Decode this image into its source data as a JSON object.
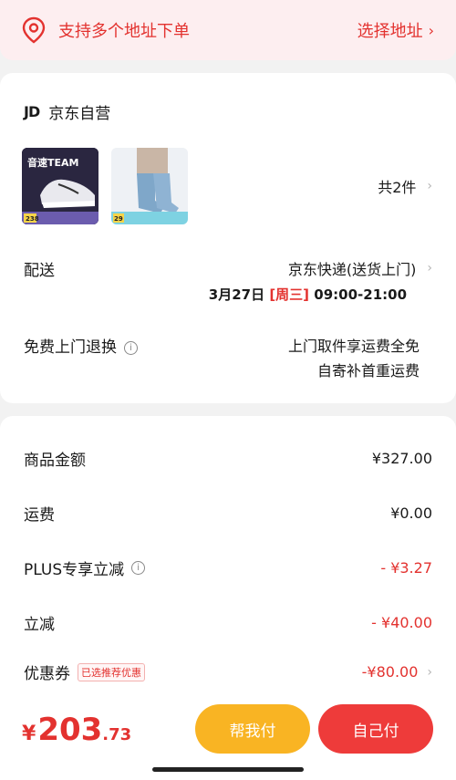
{
  "address_bar": {
    "text": "支持多个地址下单",
    "action": "选择地址"
  },
  "shop": {
    "logo": "JD",
    "name": "京东自营"
  },
  "products": [
    {
      "name": "shoe",
      "badge": "音速TEAM",
      "price_tag": "238"
    },
    {
      "name": "socks",
      "price_tag": "29"
    }
  ],
  "item_count": "共2件",
  "delivery": {
    "label": "配送",
    "method": "京东快递(送货上门)",
    "date": "3月27日",
    "weekday": "[周三]",
    "time": "09:00-21:00"
  },
  "returns": {
    "label": "免费上门退换",
    "line1": "上门取件享运费全免",
    "line2": "自寄补首重运费"
  },
  "price_rows": [
    {
      "label": "商品金额",
      "value": "¥327.00"
    },
    {
      "label": "运费",
      "value": "¥0.00"
    },
    {
      "label": "PLUS专享立减",
      "value": "- ¥3.27"
    },
    {
      "label": "立减",
      "value": "- ¥40.00"
    },
    {
      "label": "优惠券",
      "tag": "已选推荐优惠",
      "value": "-¥80.00"
    }
  ],
  "total": {
    "currency": "¥",
    "integer": "203",
    "decimal": ".73"
  },
  "buttons": {
    "help_pay": "帮我付",
    "self_pay": "自己付"
  },
  "colors": {
    "accent": "#e3322f",
    "help_button": "#f9b423",
    "pay_button": "#ee3b3a"
  }
}
